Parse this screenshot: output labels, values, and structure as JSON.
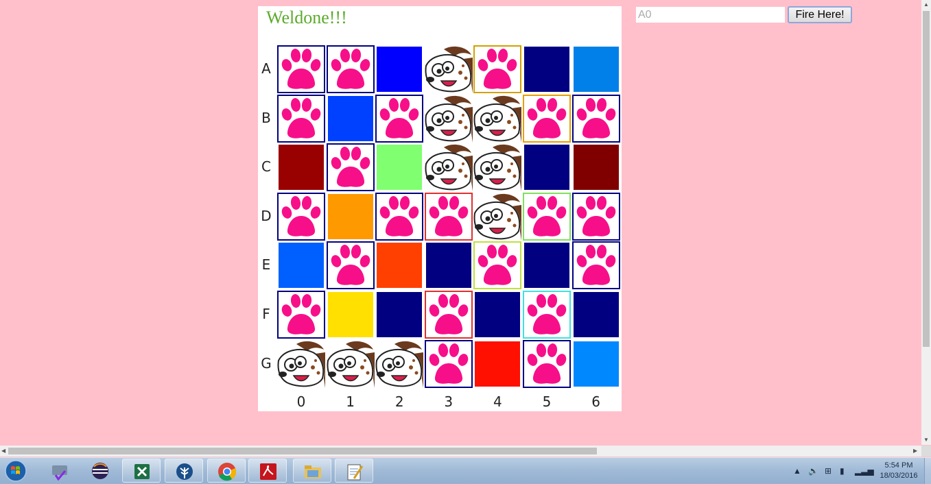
{
  "game": {
    "status_message": "Weldone!!!",
    "row_labels": [
      "A",
      "B",
      "C",
      "D",
      "E",
      "F",
      "G"
    ],
    "col_labels": [
      "0",
      "1",
      "2",
      "3",
      "4",
      "5",
      "6"
    ],
    "grid": [
      [
        {
          "t": "paw",
          "b": "#000080"
        },
        {
          "t": "paw",
          "b": "#000080"
        },
        {
          "t": "color",
          "c": "#0000ff"
        },
        {
          "t": "dog"
        },
        {
          "t": "paw",
          "b": "#d4a000"
        },
        {
          "t": "color",
          "c": "#000080"
        },
        {
          "t": "color",
          "c": "#0080e8"
        }
      ],
      [
        {
          "t": "paw",
          "b": "#000080"
        },
        {
          "t": "color",
          "c": "#0040ff"
        },
        {
          "t": "paw",
          "b": "#000080"
        },
        {
          "t": "dog"
        },
        {
          "t": "dog"
        },
        {
          "t": "paw",
          "b": "#e8a000"
        },
        {
          "t": "paw",
          "b": "#000080"
        }
      ],
      [
        {
          "t": "color",
          "c": "#990000"
        },
        {
          "t": "paw",
          "b": "#000080"
        },
        {
          "t": "color",
          "c": "#80ff70"
        },
        {
          "t": "dog"
        },
        {
          "t": "dog"
        },
        {
          "t": "color",
          "c": "#000080"
        },
        {
          "t": "color",
          "c": "#800000"
        }
      ],
      [
        {
          "t": "paw",
          "b": "#000080"
        },
        {
          "t": "color",
          "c": "#ff9900"
        },
        {
          "t": "paw",
          "b": "#000080"
        },
        {
          "t": "paw",
          "b": "#e03030"
        },
        {
          "t": "dog"
        },
        {
          "t": "paw",
          "b": "#80e060"
        },
        {
          "t": "paw",
          "b": "#000080"
        }
      ],
      [
        {
          "t": "color",
          "c": "#0060ff"
        },
        {
          "t": "paw",
          "b": "#000080"
        },
        {
          "t": "color",
          "c": "#ff4000"
        },
        {
          "t": "color",
          "c": "#000080"
        },
        {
          "t": "paw",
          "b": "#c0e040"
        },
        {
          "t": "color",
          "c": "#000080"
        },
        {
          "t": "paw",
          "b": "#000080"
        }
      ],
      [
        {
          "t": "paw",
          "b": "#000080"
        },
        {
          "t": "color",
          "c": "#ffe000"
        },
        {
          "t": "color",
          "c": "#000080"
        },
        {
          "t": "paw",
          "b": "#e03030"
        },
        {
          "t": "color",
          "c": "#000080"
        },
        {
          "t": "paw",
          "b": "#40e0e0"
        },
        {
          "t": "color",
          "c": "#000080"
        }
      ],
      [
        {
          "t": "dog"
        },
        {
          "t": "dog"
        },
        {
          "t": "dog"
        },
        {
          "t": "paw",
          "b": "#000080"
        },
        {
          "t": "color",
          "c": "#ff1000"
        },
        {
          "t": "paw",
          "b": "#000080"
        },
        {
          "t": "color",
          "c": "#0088ff"
        }
      ]
    ]
  },
  "controls": {
    "coordinate_placeholder": "A0",
    "fire_label": "Fire Here!"
  },
  "taskbar": {
    "apps": [
      "computer-admin-icon",
      "eclipse-icon",
      "excel-icon",
      "tree-app-icon",
      "chrome-icon",
      "acrobat-icon",
      "file-explorer-icon",
      "notepad-icon"
    ],
    "clock_time": "5:54 PM",
    "clock_date": "18/03/2016"
  },
  "colors": {
    "page_background": "#ffc0cb",
    "paw": "#f70f8a",
    "status_text": "#5bab2b"
  }
}
